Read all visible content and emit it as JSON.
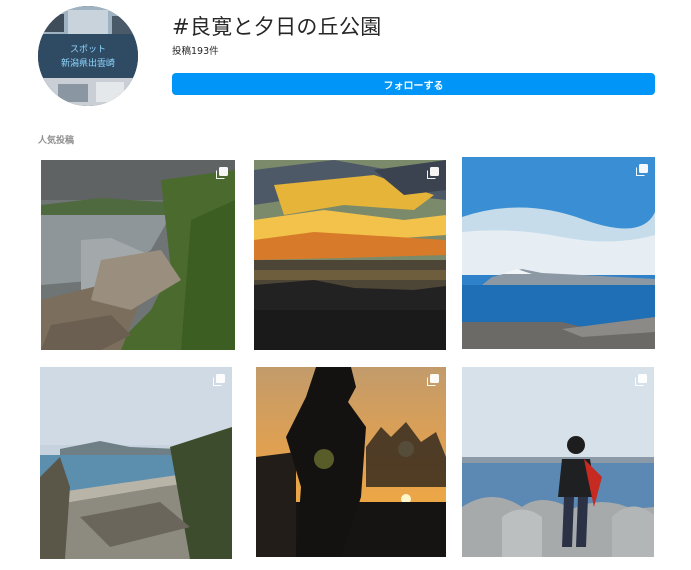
{
  "hashtag": {
    "title": "#良寛と夕日の丘公園",
    "post_count": "投稿193件",
    "follow_label": "フォローする",
    "avatar_caption": "スポット",
    "avatar_caption_2": "新潟県出雲崎"
  },
  "top_posts": {
    "heading": "人気投稿"
  },
  "colors": {
    "accent": "#0095f6",
    "text": "#262626",
    "muted": "#8e8e8e"
  },
  "posts": [
    {
      "subject": "coastal town with harbor and green hills",
      "icon": "multiple-images-icon"
    },
    {
      "subject": "golden sunset clouds over sea",
      "icon": "multiple-images-icon"
    },
    {
      "subject": "snowy mountain across blue sea with breakwater",
      "icon": "multiple-images-icon"
    },
    {
      "subject": "seaside village with bay and mountain",
      "icon": "multiple-images-icon"
    },
    {
      "subject": "statue silhouette at sunset",
      "icon": "multiple-images-icon"
    },
    {
      "subject": "person in red scarf on wave breakers",
      "icon": "multiple-images-icon"
    }
  ]
}
